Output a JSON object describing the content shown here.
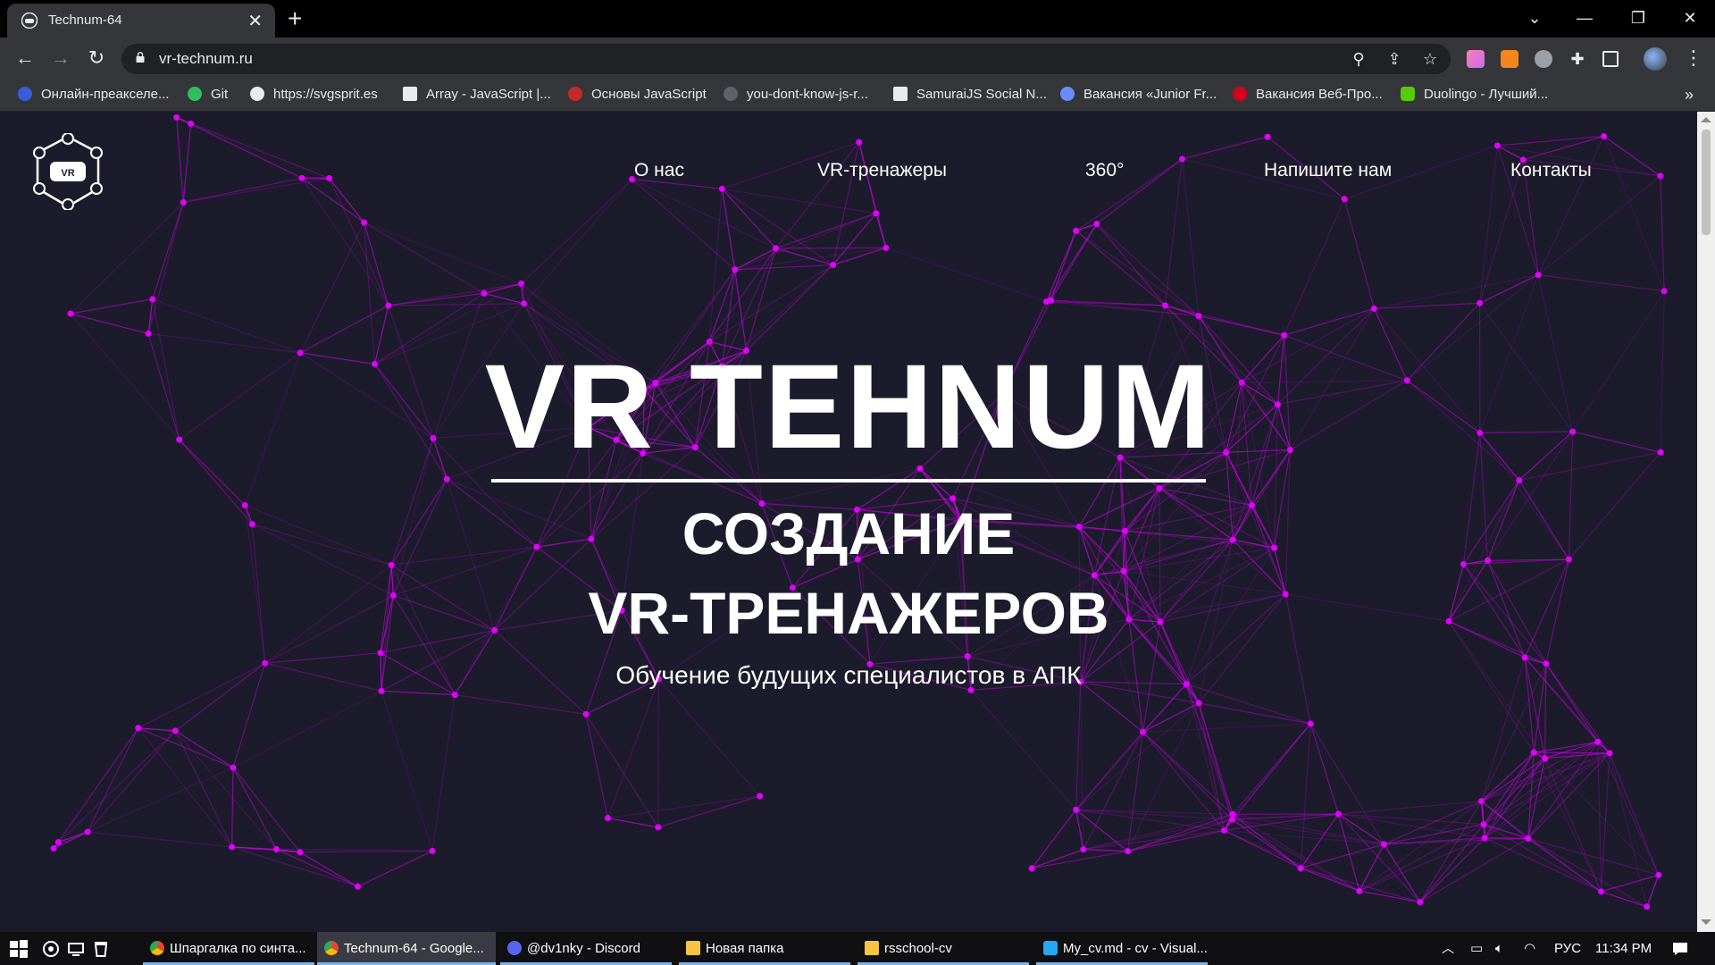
{
  "browser": {
    "tab": {
      "title": "Technum-64",
      "close": "✕"
    },
    "new_tab": "+",
    "window_controls": {
      "tab_search": "⌄",
      "minimize": "—",
      "restore": "❐",
      "close": "✕"
    },
    "nav": {
      "back": "←",
      "forward": "→",
      "reload": "↻"
    },
    "address": {
      "url": "vr-technum.ru"
    },
    "omnibox_icons": {
      "zoom": "⚲",
      "share": "⇪",
      "bookmark": "☆"
    },
    "menu": "⋮",
    "bookmarks": [
      {
        "label": "Онлайн-преакселе...",
        "icon": "incubator-icon",
        "color": "#3b5bdb"
      },
      {
        "label": "Git",
        "icon": "evernote-icon",
        "color": "#2dbe60"
      },
      {
        "label": "https://svgsprit.es",
        "icon": "globe-icon",
        "color": "#e8eaed"
      },
      {
        "label": "Array - JavaScript |...",
        "icon": "mdn-icon",
        "color": "#e8eaed"
      },
      {
        "label": "Основы JavaScript",
        "icon": "figure-icon",
        "color": "#c62828"
      },
      {
        "label": "you-dont-know-js-r...",
        "icon": "github-icon",
        "color": "#5f6368"
      },
      {
        "label": "SamuraiJS Social N...",
        "icon": "document-icon",
        "color": "#e8eaed"
      },
      {
        "label": "Вакансия «Junior Fr...",
        "icon": "gear-badge-icon",
        "color": "#6b8cff"
      },
      {
        "label": "Вакансия Веб-Про...",
        "icon": "hh-icon",
        "color": "#d6001c"
      },
      {
        "label": "Duolingo - Лучший...",
        "icon": "duolingo-icon",
        "color": "#58cc02"
      }
    ],
    "more_bookmarks": "»"
  },
  "site": {
    "nav": [
      "О нас",
      "VR-тренажеры",
      "360°",
      "Напишите нам",
      "Контакты"
    ],
    "hero": {
      "title": "VR TEHNUM",
      "subtitle_line1": "СОЗДАНИЕ",
      "subtitle_line2": "VR-ТРЕНАЖЕРОВ",
      "description": "Обучение будущих специалистов в АПК"
    },
    "logo_badge": "VR",
    "colors": {
      "background": "#1c1b2b",
      "network": "#e100ff",
      "text": "#ffffff"
    }
  },
  "taskbar": {
    "apps": [
      {
        "label": "Шпаргалка по синта...",
        "icon": "chrome-icon",
        "active": false
      },
      {
        "label": "Technum-64 - Google...",
        "icon": "chrome-icon",
        "active": true
      },
      {
        "label": "@dv1nky - Discord",
        "icon": "discord-icon",
        "active": false
      },
      {
        "label": "Новая папка",
        "icon": "folder-icon",
        "active": false
      },
      {
        "label": "rsschool-cv",
        "icon": "folder-icon",
        "active": false
      },
      {
        "label": "My_cv.md - cv - Visual...",
        "icon": "vscode-icon",
        "active": false
      }
    ],
    "language": "РУС",
    "time": "11:34 PM"
  }
}
